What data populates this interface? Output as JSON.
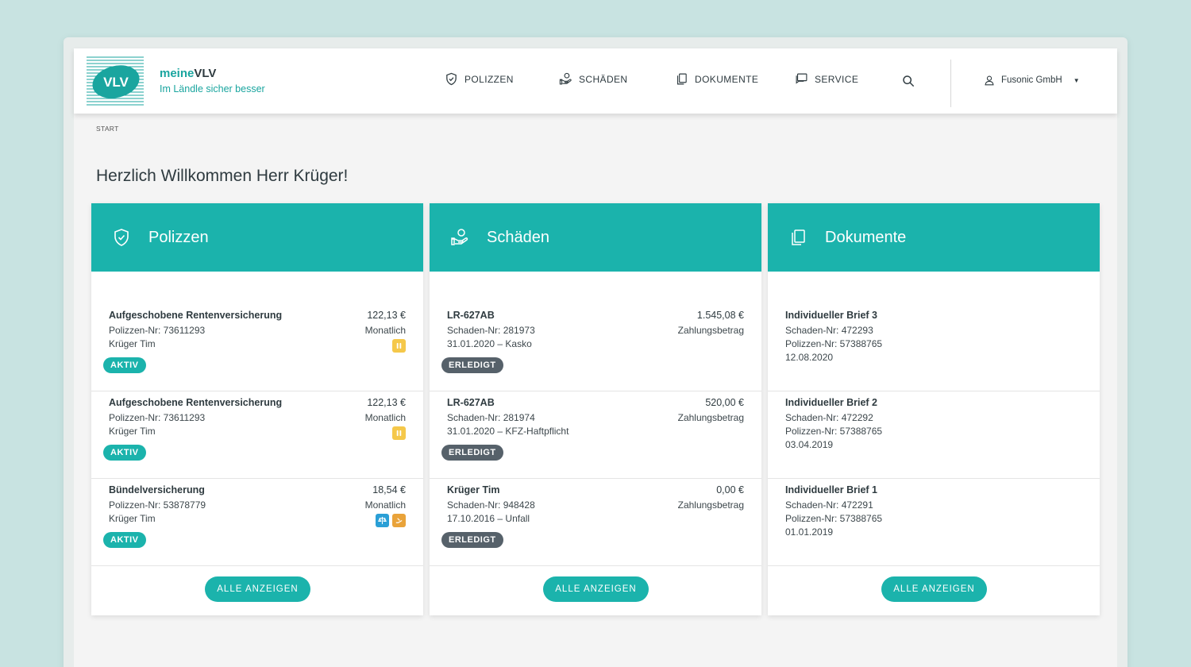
{
  "brand": {
    "logo_text": "VLV",
    "name_prefix": "meine",
    "name_suffix": "VLV",
    "tagline": "Im Ländle sicher besser"
  },
  "nav": [
    {
      "label": "POLIZZEN",
      "icon": "shield-icon"
    },
    {
      "label": "SCHÄDEN",
      "icon": "hand-coin-icon"
    },
    {
      "label": "DOKUMENTE",
      "icon": "documents-icon"
    },
    {
      "label": "SERVICE",
      "icon": "chat-icon"
    }
  ],
  "user": {
    "name": "Fusonic GmbH"
  },
  "breadcrumb": "START",
  "welcome": "Herzlich Willkommen Herr Krüger!",
  "colors": {
    "accent": "#1bb3ac",
    "badge_done": "#56616a",
    "icon_yellow": "#f5c84a",
    "icon_blue": "#2a9fd6",
    "icon_orange": "#e9a33a"
  },
  "cards": [
    {
      "title": "Polizzen",
      "button": "ALLE ANZEIGEN",
      "rows": [
        {
          "title": "Aufgeschobene Rentenversicherung",
          "line2": "Polizzen-Nr: 73611293",
          "line3": "Krüger Tim",
          "amount": "122,13 €",
          "sub": "Monatlich",
          "badge": "AKTIV"
        },
        {
          "title": "Aufgeschobene Rentenversicherung",
          "line2": "Polizzen-Nr: 73611293",
          "line3": "Krüger Tim",
          "amount": "122,13 €",
          "sub": "Monatlich",
          "badge": "AKTIV"
        },
        {
          "title": "Bündelversicherung",
          "line2": "Polizzen-Nr: 53878779",
          "line3": "Krüger Tim",
          "amount": "18,54 €",
          "sub": "Monatlich",
          "badge": "AKTIV"
        }
      ]
    },
    {
      "title": "Schäden",
      "button": "ALLE ANZEIGEN",
      "rows": [
        {
          "title": "LR-627AB",
          "line2": "Schaden-Nr: 281973",
          "line3": "31.01.2020 – Kasko",
          "amount": "1.545,08 €",
          "sub": "Zahlungsbetrag",
          "badge": "ERLEDIGT"
        },
        {
          "title": "LR-627AB",
          "line2": "Schaden-Nr: 281974",
          "line3": "31.01.2020 – KFZ-Haftpflicht",
          "amount": "520,00 €",
          "sub": "Zahlungsbetrag",
          "badge": "ERLEDIGT"
        },
        {
          "title": "Krüger Tim",
          "line2": "Schaden-Nr: 948428",
          "line3": "17.10.2016 – Unfall",
          "amount": "0,00 €",
          "sub": "Zahlungsbetrag",
          "badge": "ERLEDIGT"
        }
      ]
    },
    {
      "title": "Dokumente",
      "button": "ALLE ANZEIGEN",
      "rows": [
        {
          "title": "Individueller Brief 3",
          "line2": "Schaden-Nr: 472293",
          "line3": "Polizzen-Nr: 57388765",
          "line4": "12.08.2020"
        },
        {
          "title": "Individueller Brief 2",
          "line2": "Schaden-Nr: 472292",
          "line3": "Polizzen-Nr: 57388765",
          "line4": "03.04.2019"
        },
        {
          "title": "Individueller Brief 1",
          "line2": "Schaden-Nr: 472291",
          "line3": "Polizzen-Nr: 57388765",
          "line4": "01.01.2019"
        }
      ]
    }
  ]
}
